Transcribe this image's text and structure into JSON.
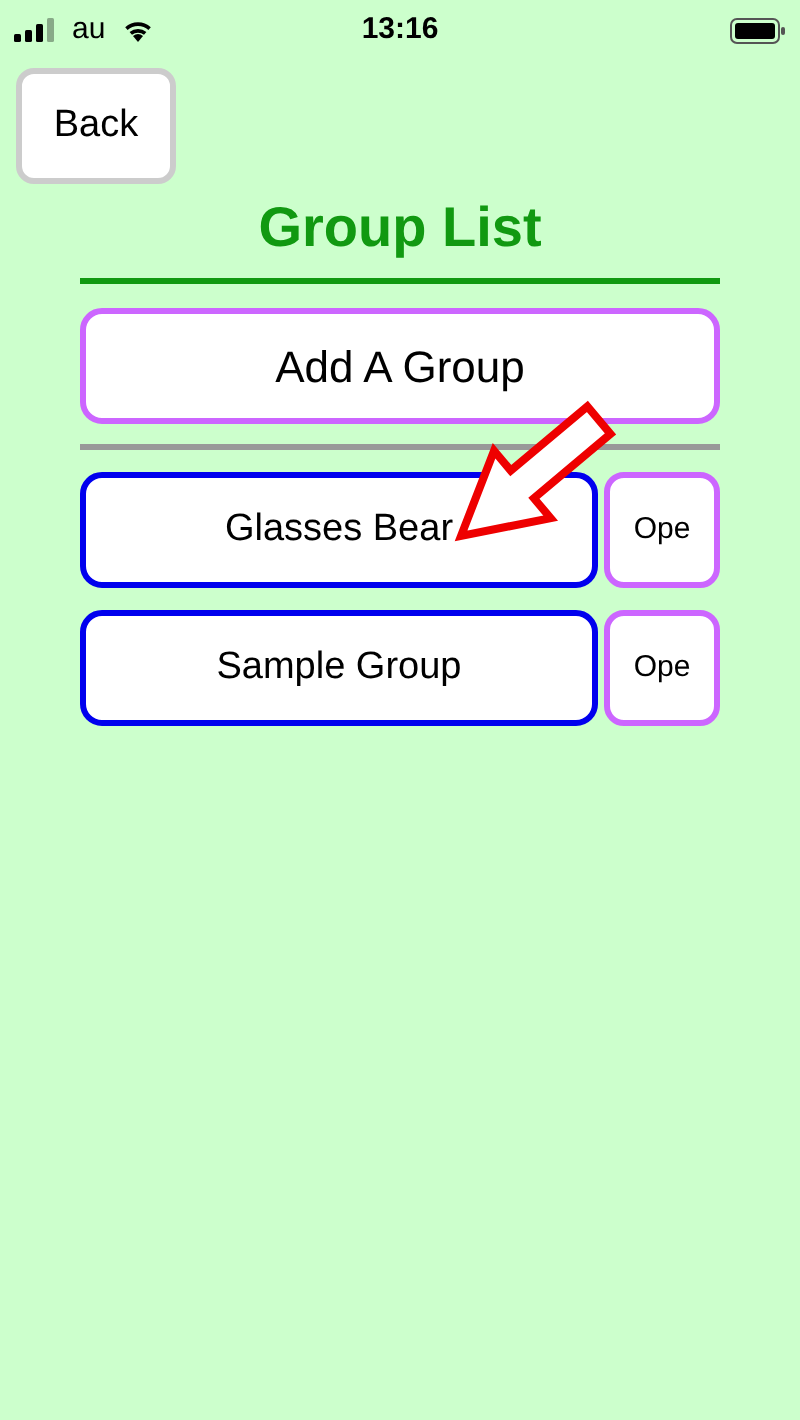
{
  "status_bar": {
    "carrier": "au",
    "time": "13:16"
  },
  "back_button": {
    "label": "Back"
  },
  "title": "Group List",
  "add_button": {
    "label": "Add A Group"
  },
  "groups": [
    {
      "name": "Glasses Bear",
      "action": "Ope"
    },
    {
      "name": "Sample Group",
      "action": "Ope"
    }
  ]
}
